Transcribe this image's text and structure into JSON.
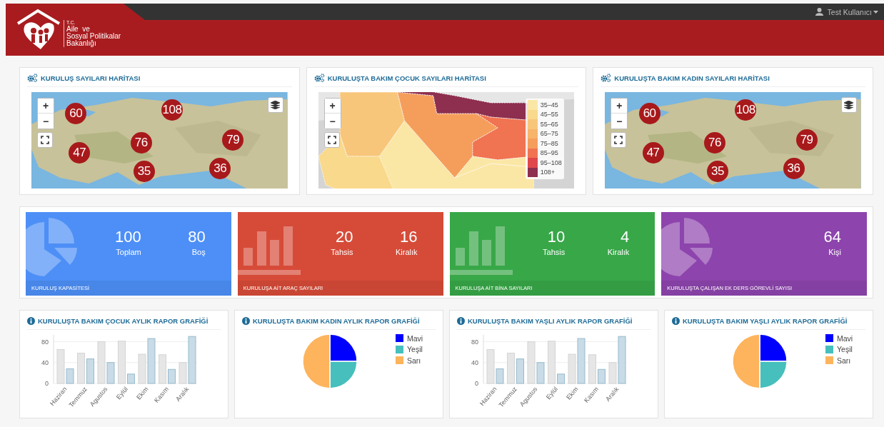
{
  "header": {
    "logo_lines": [
      "T.C.",
      "Aile  ve",
      "Sosyal Politikalar",
      "Bakanlığı"
    ],
    "user": "Test Kullanıcı"
  },
  "maps": [
    {
      "title": "KURULUŞ SAYILARI HARİTASI",
      "kind": "clusters",
      "zoom_in": "+",
      "zoom_out": "−",
      "markers": [
        {
          "label": "60"
        },
        {
          "label": "108"
        },
        {
          "label": "76"
        },
        {
          "label": "79"
        },
        {
          "label": "47"
        },
        {
          "label": "35"
        },
        {
          "label": "36"
        }
      ]
    },
    {
      "title": "KURULUŞTA BAKIM ÇOCUK SAYILARI HARİTASI",
      "kind": "choropleth",
      "zoom_in": "+",
      "zoom_out": "−",
      "legend": [
        {
          "label": "35–45",
          "color": "#fbe7a5"
        },
        {
          "label": "45–55",
          "color": "#f9d98b"
        },
        {
          "label": "55–65",
          "color": "#f8c67a"
        },
        {
          "label": "65–75",
          "color": "#f7b46b"
        },
        {
          "label": "75–85",
          "color": "#f59e5c"
        },
        {
          "label": "85–95",
          "color": "#f07352"
        },
        {
          "label": "95–108",
          "color": "#e0474b"
        },
        {
          "label": "108+",
          "color": "#8e2f4f"
        }
      ]
    },
    {
      "title": "KURULUŞTA BAKIM KADIN SAYILARI HARİTASI",
      "kind": "clusters",
      "zoom_in": "+",
      "zoom_out": "−",
      "markers": [
        {
          "label": "60"
        },
        {
          "label": "108"
        },
        {
          "label": "76"
        },
        {
          "label": "79"
        },
        {
          "label": "47"
        },
        {
          "label": "35"
        },
        {
          "label": "36"
        }
      ]
    }
  ],
  "stat_cards": [
    {
      "title": "KURULUŞ KAPASİTESİ",
      "color": "#4d8ff6",
      "kind": "pie",
      "stats": [
        {
          "value": "100",
          "label": "Toplam"
        },
        {
          "value": "80",
          "label": "Boş"
        }
      ]
    },
    {
      "title": "KURULUŞA AİT ARAÇ SAYILARI",
      "color": "#d64b38",
      "kind": "bars",
      "stats": [
        {
          "value": "20",
          "label": "Tahsis"
        },
        {
          "value": "16",
          "label": "Kiralık"
        }
      ]
    },
    {
      "title": "KURULUŞA AİT BİNA SAYILARI",
      "color": "#38a748",
      "kind": "bars",
      "stats": [
        {
          "value": "10",
          "label": "Tahsis"
        },
        {
          "value": "4",
          "label": "Kiralık"
        }
      ]
    },
    {
      "title": "KURULUŞTA ÇALIŞAN EK DERS GÖREVLİ SAYISI",
      "color": "#8d44ad",
      "kind": "pie",
      "stats": [
        {
          "value": "64",
          "label": "Kişi"
        }
      ]
    }
  ],
  "report_charts": [
    {
      "title": "KURULUŞTA BAKIM ÇOCUK AYLIK RAPOR GRAFİĞİ",
      "chart_data": {
        "type": "bar",
        "categories": [
          "Haziran",
          "Temmuz",
          "Agustos",
          "Eylül",
          "Ekim",
          "Kasım",
          "Aralık"
        ],
        "series": [
          {
            "color": "#e6e6e6",
            "values": [
              65,
              58,
              80,
              81,
              56,
              55,
              40
            ]
          },
          {
            "color": "#c8dbe6",
            "values": [
              28,
              47,
              40,
              18,
              86,
              27,
              90
            ]
          }
        ],
        "ylim": [
          0,
          93
        ],
        "yticks": [
          0,
          40,
          80
        ]
      }
    },
    {
      "title": "KURULUŞTA BAKIM KADIN AYLIK RAPOR GRAFİĞİ",
      "legend": [
        {
          "color": "#0000ff"
        },
        {
          "color": "#46bfbd"
        },
        {
          "color": "#fdb45c"
        }
      ],
      "chart_data": {
        "type": "pie",
        "categories": [
          "Mavi",
          "Yeşil",
          "Sarı"
        ],
        "values": [
          25,
          25,
          50
        ],
        "legend": "right"
      }
    },
    {
      "title": "KURULUŞTA BAKIM YAŞLI AYLIK RAPOR GRAFİĞİ",
      "chart_data": {
        "type": "bar",
        "categories": [
          "Haziran",
          "Temmuz",
          "Agustos",
          "Eylül",
          "Ekim",
          "Kasım",
          "Aralık"
        ],
        "series": [
          {
            "color": "#e6e6e6",
            "values": [
              65,
              58,
              80,
              81,
              56,
              55,
              40
            ]
          },
          {
            "color": "#c8dbe6",
            "values": [
              28,
              47,
              40,
              18,
              86,
              27,
              90
            ]
          }
        ],
        "ylim": [
          0,
          93
        ],
        "yticks": [
          0,
          40,
          80
        ]
      }
    },
    {
      "title": "KURULUŞTA BAKIM YAŞLI AYLIK RAPOR GRAFİĞİ",
      "legend": [
        {
          "color": "#0000ff"
        },
        {
          "color": "#46bfbd"
        },
        {
          "color": "#fdb45c"
        }
      ],
      "chart_data": {
        "type": "pie",
        "categories": [
          "Mavi",
          "Yeşil",
          "Sarı"
        ],
        "values": [
          25,
          25,
          50
        ],
        "legend": "right"
      }
    }
  ]
}
